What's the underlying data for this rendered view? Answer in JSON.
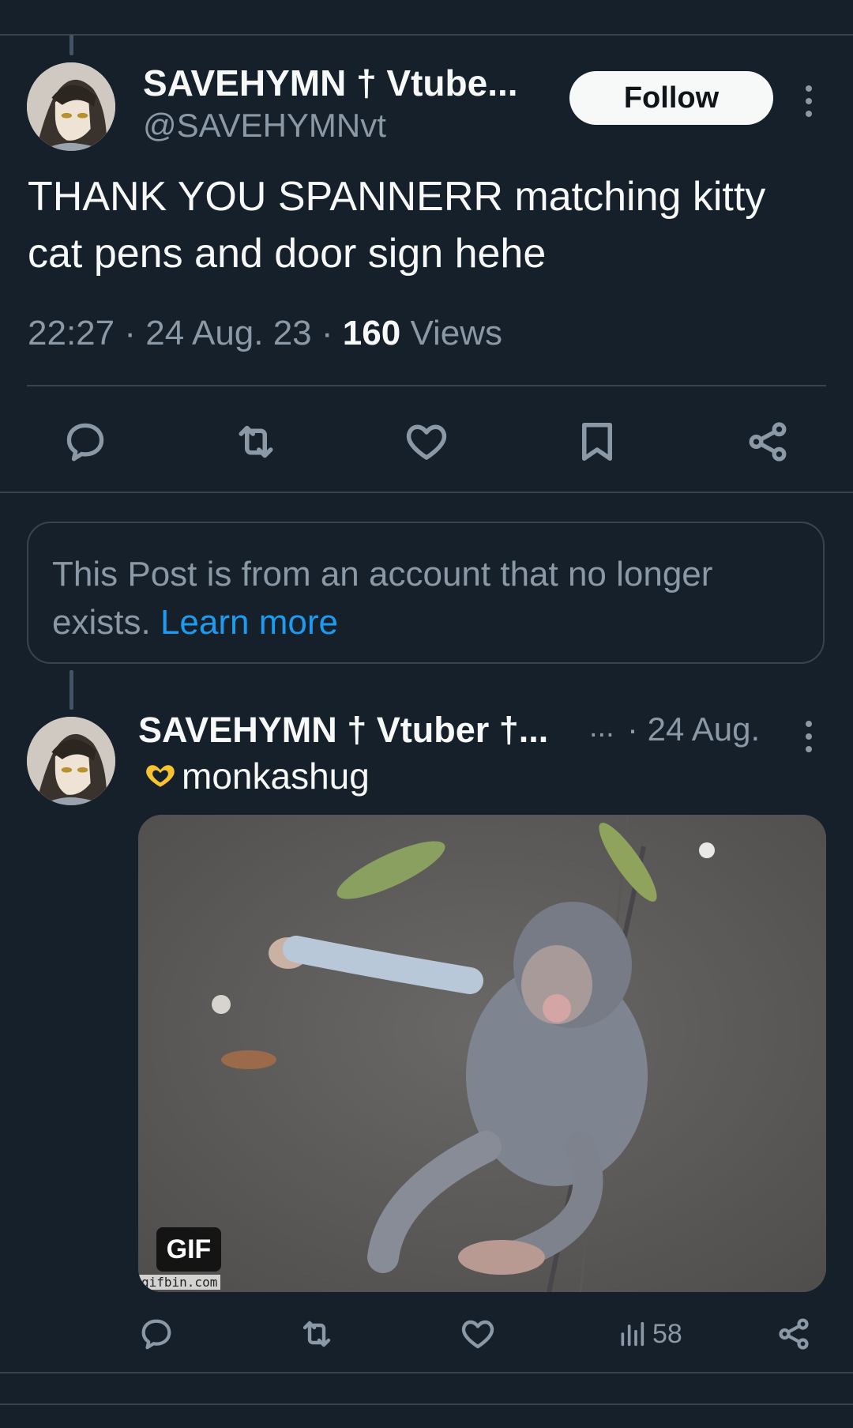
{
  "main_tweet": {
    "display_name": "SAVEHYMN † Vtube...",
    "handle": "@SAVEHYMNvt",
    "follow_label": "Follow",
    "text": "THANK YOU SPANNERR matching kitty cat pens and door sign hehe",
    "time": "22:27",
    "date": "24 Aug. 23",
    "views_count": "160",
    "views_label": "Views",
    "actions": [
      "reply-icon",
      "retweet-icon",
      "like-icon",
      "bookmark-icon",
      "share-icon"
    ]
  },
  "notice": {
    "text": "This Post is from an account that no longer exists.",
    "link": "Learn more"
  },
  "reply_tweet": {
    "display_name": "SAVEHYMN † Vtuber †...",
    "ellipsis": "...",
    "date": "· 24 Aug.",
    "text": "monkashug",
    "emoji": "heart-hands-emoji",
    "gif_badge": "GIF",
    "gif_watermark": "gifbin.com",
    "views_count": "58",
    "actions": [
      "reply-icon",
      "retweet-icon",
      "like-icon",
      "views-icon",
      "share-icon"
    ]
  },
  "colors": {
    "background": "#15202b",
    "divider": "#38444d",
    "secondary_text": "#8b98a5",
    "link": "#1d9bf0"
  }
}
